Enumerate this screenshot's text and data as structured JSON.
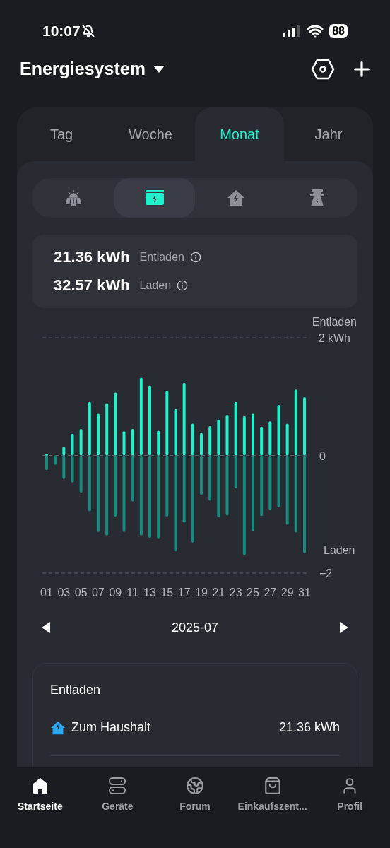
{
  "status_bar": {
    "time": "10:07",
    "battery": "88"
  },
  "header": {
    "title": "Energiesystem"
  },
  "period_tabs": [
    {
      "label": "Tag",
      "selected": false
    },
    {
      "label": "Woche",
      "selected": false
    },
    {
      "label": "Monat",
      "selected": true
    },
    {
      "label": "Jahr",
      "selected": false
    }
  ],
  "sources": [
    {
      "kind": "solar",
      "selected": false
    },
    {
      "kind": "battery",
      "selected": true
    },
    {
      "kind": "home",
      "selected": false
    },
    {
      "kind": "grid",
      "selected": false
    }
  ],
  "totals": [
    {
      "value": "21.36 kWh",
      "label": "Entladen"
    },
    {
      "value": "32.57 kWh",
      "label": "Laden"
    }
  ],
  "chart": {
    "chart_data": {
      "type": "bar",
      "stacked": true,
      "x": [
        1,
        2,
        3,
        4,
        5,
        6,
        7,
        8,
        9,
        10,
        11,
        12,
        13,
        14,
        15,
        16,
        17,
        18,
        19,
        20,
        21,
        22,
        23,
        24,
        25,
        26,
        27,
        28,
        29,
        30,
        31
      ],
      "xticks": [
        {
          "value": 1,
          "label": "01"
        },
        {
          "value": 3,
          "label": "03"
        },
        {
          "value": 5,
          "label": "05"
        },
        {
          "value": 7,
          "label": "07"
        },
        {
          "value": 9,
          "label": "09"
        },
        {
          "value": 11,
          "label": "11"
        },
        {
          "value": 13,
          "label": "13"
        },
        {
          "value": 15,
          "label": "15"
        },
        {
          "value": 17,
          "label": "17"
        },
        {
          "value": 19,
          "label": "19"
        },
        {
          "value": 21,
          "label": "21"
        },
        {
          "value": 23,
          "label": "23"
        },
        {
          "value": 25,
          "label": "25"
        },
        {
          "value": 27,
          "label": "27"
        },
        {
          "value": 29,
          "label": "29"
        },
        {
          "value": 31,
          "label": "31"
        }
      ],
      "xlim": [
        1,
        31
      ],
      "ylim": [
        -2,
        2
      ],
      "yticks": [
        {
          "value": 2,
          "label": "2 kWh"
        },
        0,
        {
          "value": -2,
          "label": "−2"
        }
      ],
      "series": [
        {
          "name": "Entladen",
          "color": "#1ff2cb",
          "values": [
            0.03,
            0,
            0.15,
            0.37,
            0.45,
            0.91,
            0.71,
            0.89,
            1.07,
            0.41,
            0.45,
            1.32,
            1.19,
            0.42,
            1.1,
            0.79,
            1.23,
            0.54,
            0.38,
            0.5,
            0.61,
            0.69,
            0.91,
            0.67,
            0.71,
            0.49,
            0.58,
            0.86,
            0.54,
            1.12,
            0.99
          ]
        },
        {
          "name": "Laden",
          "color": "#178c7d",
          "values": [
            -0.25,
            -0.16,
            -0.4,
            -0.46,
            -0.63,
            -0.95,
            -1.3,
            -1.36,
            -1.04,
            -1.3,
            -0.78,
            -1.36,
            -1.4,
            -1.42,
            -1.04,
            -1.63,
            -1.14,
            -1.48,
            -0.67,
            -0.77,
            -1.05,
            -1.02,
            -0.56,
            -1.69,
            -1.29,
            -1.03,
            -0.93,
            -0.88,
            -1.18,
            -1.31,
            -1.66
          ]
        }
      ]
    }
  },
  "period": {
    "label": "2025-07"
  },
  "breakdown": {
    "title": "Entladen",
    "rows": [
      {
        "label": "Zum Haushalt",
        "value": "21.36 kWh"
      }
    ]
  },
  "bottom_nav": [
    {
      "kind": "home",
      "label": "Startseite",
      "selected": true
    },
    {
      "kind": "devices",
      "label": "Geräte",
      "selected": false
    },
    {
      "kind": "forum",
      "label": "Forum",
      "selected": false
    },
    {
      "kind": "shop",
      "label": "Einkaufszent...",
      "selected": false
    },
    {
      "kind": "profile",
      "label": "Profil",
      "selected": false
    }
  ]
}
